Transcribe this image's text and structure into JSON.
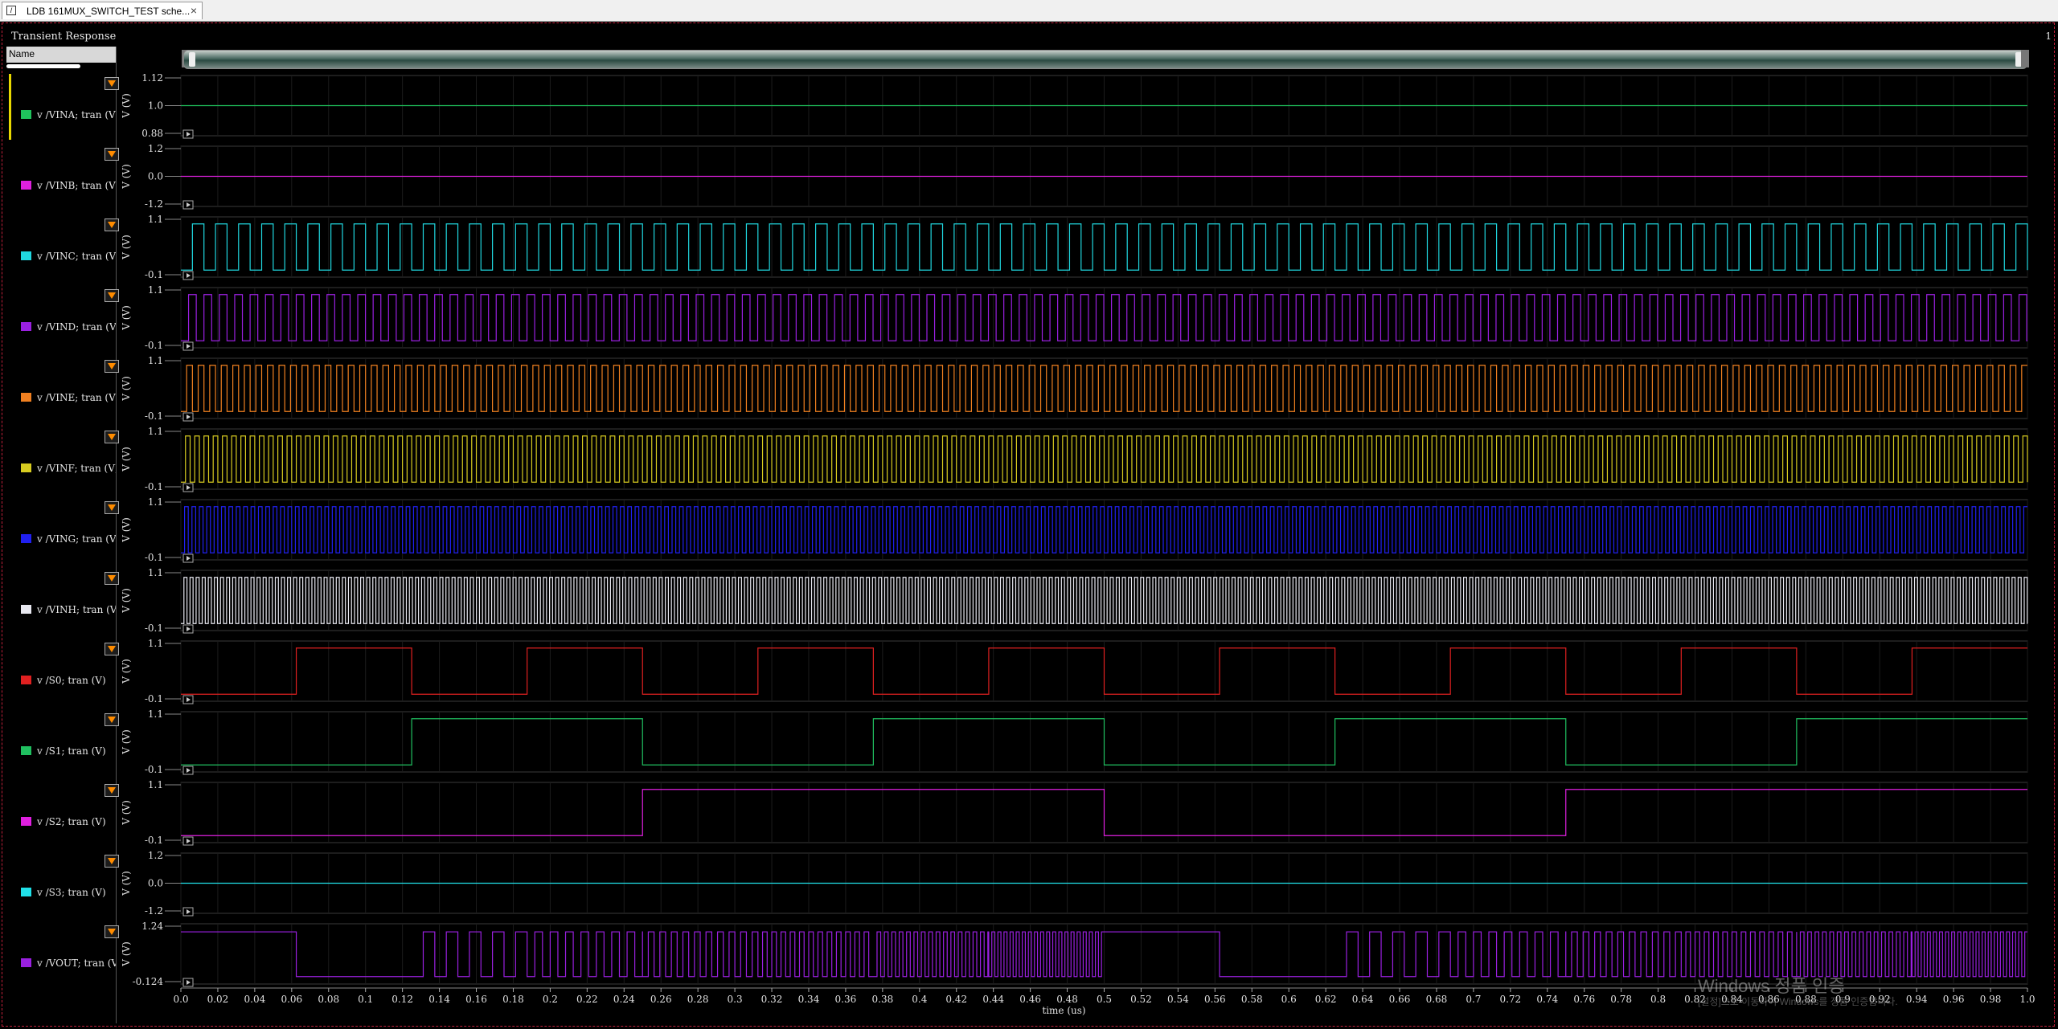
{
  "tab": {
    "title": "LDB 161MUX_SWITCH_TEST sche...",
    "close": "×"
  },
  "window": {
    "title": "Transient Response",
    "subwindow_number": "1"
  },
  "legend": {
    "header": "Name"
  },
  "watermark": {
    "line1": "Windows 정품 인증",
    "line2": "[설정]으로 이동하여 Windows를 정품 인증합니다."
  },
  "chart_data": {
    "type": "line",
    "xlabel": "time (us)",
    "xlim": [
      0.0,
      1.0
    ],
    "x_ticks": [
      "0.0",
      "0.02",
      "0.04",
      "0.06",
      "0.08",
      "0.1",
      "0.12",
      "0.14",
      "0.16",
      "0.18",
      "0.2",
      "0.22",
      "0.24",
      "0.26",
      "0.28",
      "0.3",
      "0.32",
      "0.34",
      "0.36",
      "0.38",
      "0.4",
      "0.42",
      "0.44",
      "0.46",
      "0.48",
      "0.5",
      "0.52",
      "0.54",
      "0.56",
      "0.58",
      "0.6",
      "0.62",
      "0.64",
      "0.66",
      "0.68",
      "0.7",
      "0.72",
      "0.74",
      "0.76",
      "0.78",
      "0.8",
      "0.82",
      "0.84",
      "0.86",
      "0.88",
      "0.9",
      "0.92",
      "0.94",
      "0.96",
      "0.98",
      "1.0"
    ],
    "ylabel": "V (V)",
    "series": [
      {
        "name": "v /VINA; tran (V)",
        "color": "#1fc25c",
        "kind": "const",
        "value": 1.0,
        "ylim": [
          0.88,
          1.12
        ],
        "yticks": [
          "1.12",
          "1.0",
          "0.88"
        ]
      },
      {
        "name": "v /VINB; tran (V)",
        "color": "#e020e0",
        "kind": "const",
        "value": 0.0,
        "ylim": [
          -1.2,
          1.2
        ],
        "yticks": [
          "1.2",
          "0.0",
          "-1.2"
        ]
      },
      {
        "name": "v /VINC; tran (V)",
        "color": "#20d8e0",
        "kind": "square",
        "period_us": 0.0125,
        "low": 0.0,
        "high": 1.0,
        "ylim": [
          -0.1,
          1.1
        ],
        "yticks": [
          "1.1",
          "-0.1"
        ]
      },
      {
        "name": "v /VIND; tran (V)",
        "color": "#9a20e0",
        "kind": "square",
        "period_us": 0.00833,
        "low": 0.0,
        "high": 1.0,
        "ylim": [
          -0.1,
          1.1
        ],
        "yticks": [
          "1.1",
          "-0.1"
        ]
      },
      {
        "name": "v /VINE; tran (V)",
        "color": "#f08020",
        "kind": "square",
        "period_us": 0.00625,
        "low": 0.0,
        "high": 1.0,
        "ylim": [
          -0.1,
          1.1
        ],
        "yticks": [
          "1.1",
          "-0.1"
        ]
      },
      {
        "name": "v /VINF; tran (V)",
        "color": "#d8cc20",
        "kind": "square",
        "period_us": 0.005,
        "low": 0.0,
        "high": 1.0,
        "ylim": [
          -0.1,
          1.1
        ],
        "yticks": [
          "1.1",
          "-0.1"
        ]
      },
      {
        "name": "v /VING; tran (V)",
        "color": "#2020f0",
        "kind": "square",
        "period_us": 0.004,
        "low": 0.0,
        "high": 1.0,
        "ylim": [
          -0.1,
          1.1
        ],
        "yticks": [
          "1.1",
          "-0.1"
        ]
      },
      {
        "name": "v /VINH; tran (V)",
        "color": "#e8e8f0",
        "kind": "square",
        "period_us": 0.0033,
        "low": 0.0,
        "high": 1.0,
        "ylim": [
          -0.1,
          1.1
        ],
        "yticks": [
          "1.1",
          "-0.1"
        ]
      },
      {
        "name": "v /S0; tran (V)",
        "color": "#e02020",
        "kind": "square",
        "period_us": 0.125,
        "low": 0.0,
        "high": 1.0,
        "ylim": [
          -0.1,
          1.1
        ],
        "yticks": [
          "1.1",
          "-0.1"
        ]
      },
      {
        "name": "v /S1; tran (V)",
        "color": "#20c060",
        "kind": "square",
        "period_us": 0.25,
        "low": 0.0,
        "high": 1.0,
        "ylim": [
          -0.1,
          1.1
        ],
        "yticks": [
          "1.1",
          "-0.1"
        ]
      },
      {
        "name": "v /S2; tran (V)",
        "color": "#e020e0",
        "kind": "square",
        "period_us": 0.5,
        "low": 0.0,
        "high": 1.0,
        "ylim": [
          -0.1,
          1.1
        ],
        "yticks": [
          "1.1",
          "-0.1"
        ]
      },
      {
        "name": "v /S3; tran (V)",
        "color": "#20e0e8",
        "kind": "const",
        "value": 0.0,
        "ylim": [
          -1.2,
          1.2
        ],
        "yticks": [
          "1.2",
          "0.0",
          "-1.2"
        ]
      },
      {
        "name": "v /VOUT; tran (V)",
        "color": "#9a20e0",
        "kind": "mux",
        "low": 0.0,
        "high": 1.1,
        "ylim": [
          -0.124,
          1.24
        ],
        "yticks": [
          "1.24",
          "-0.124"
        ],
        "segments": [
          {
            "t0": 0.0,
            "t1": 0.0625,
            "mode": "high"
          },
          {
            "t0": 0.0625,
            "t1": 0.125,
            "mode": "low"
          },
          {
            "t0": 0.125,
            "t1": 0.1875,
            "period_us": 0.0125
          },
          {
            "t0": 0.1875,
            "t1": 0.25,
            "period_us": 0.00833
          },
          {
            "t0": 0.25,
            "t1": 0.3125,
            "period_us": 0.00625
          },
          {
            "t0": 0.3125,
            "t1": 0.375,
            "period_us": 0.005
          },
          {
            "t0": 0.375,
            "t1": 0.4375,
            "period_us": 0.004
          },
          {
            "t0": 0.4375,
            "t1": 0.5,
            "period_us": 0.0033
          },
          {
            "t0": 0.5,
            "t1": 0.5625,
            "mode": "high"
          },
          {
            "t0": 0.5625,
            "t1": 0.625,
            "mode": "low"
          },
          {
            "t0": 0.625,
            "t1": 0.6875,
            "period_us": 0.0125
          },
          {
            "t0": 0.6875,
            "t1": 0.75,
            "period_us": 0.00833
          },
          {
            "t0": 0.75,
            "t1": 0.8125,
            "period_us": 0.00625
          },
          {
            "t0": 0.8125,
            "t1": 0.875,
            "period_us": 0.005
          },
          {
            "t0": 0.875,
            "t1": 0.9375,
            "period_us": 0.004
          },
          {
            "t0": 0.9375,
            "t1": 1.0,
            "period_us": 0.0033
          }
        ]
      }
    ]
  }
}
